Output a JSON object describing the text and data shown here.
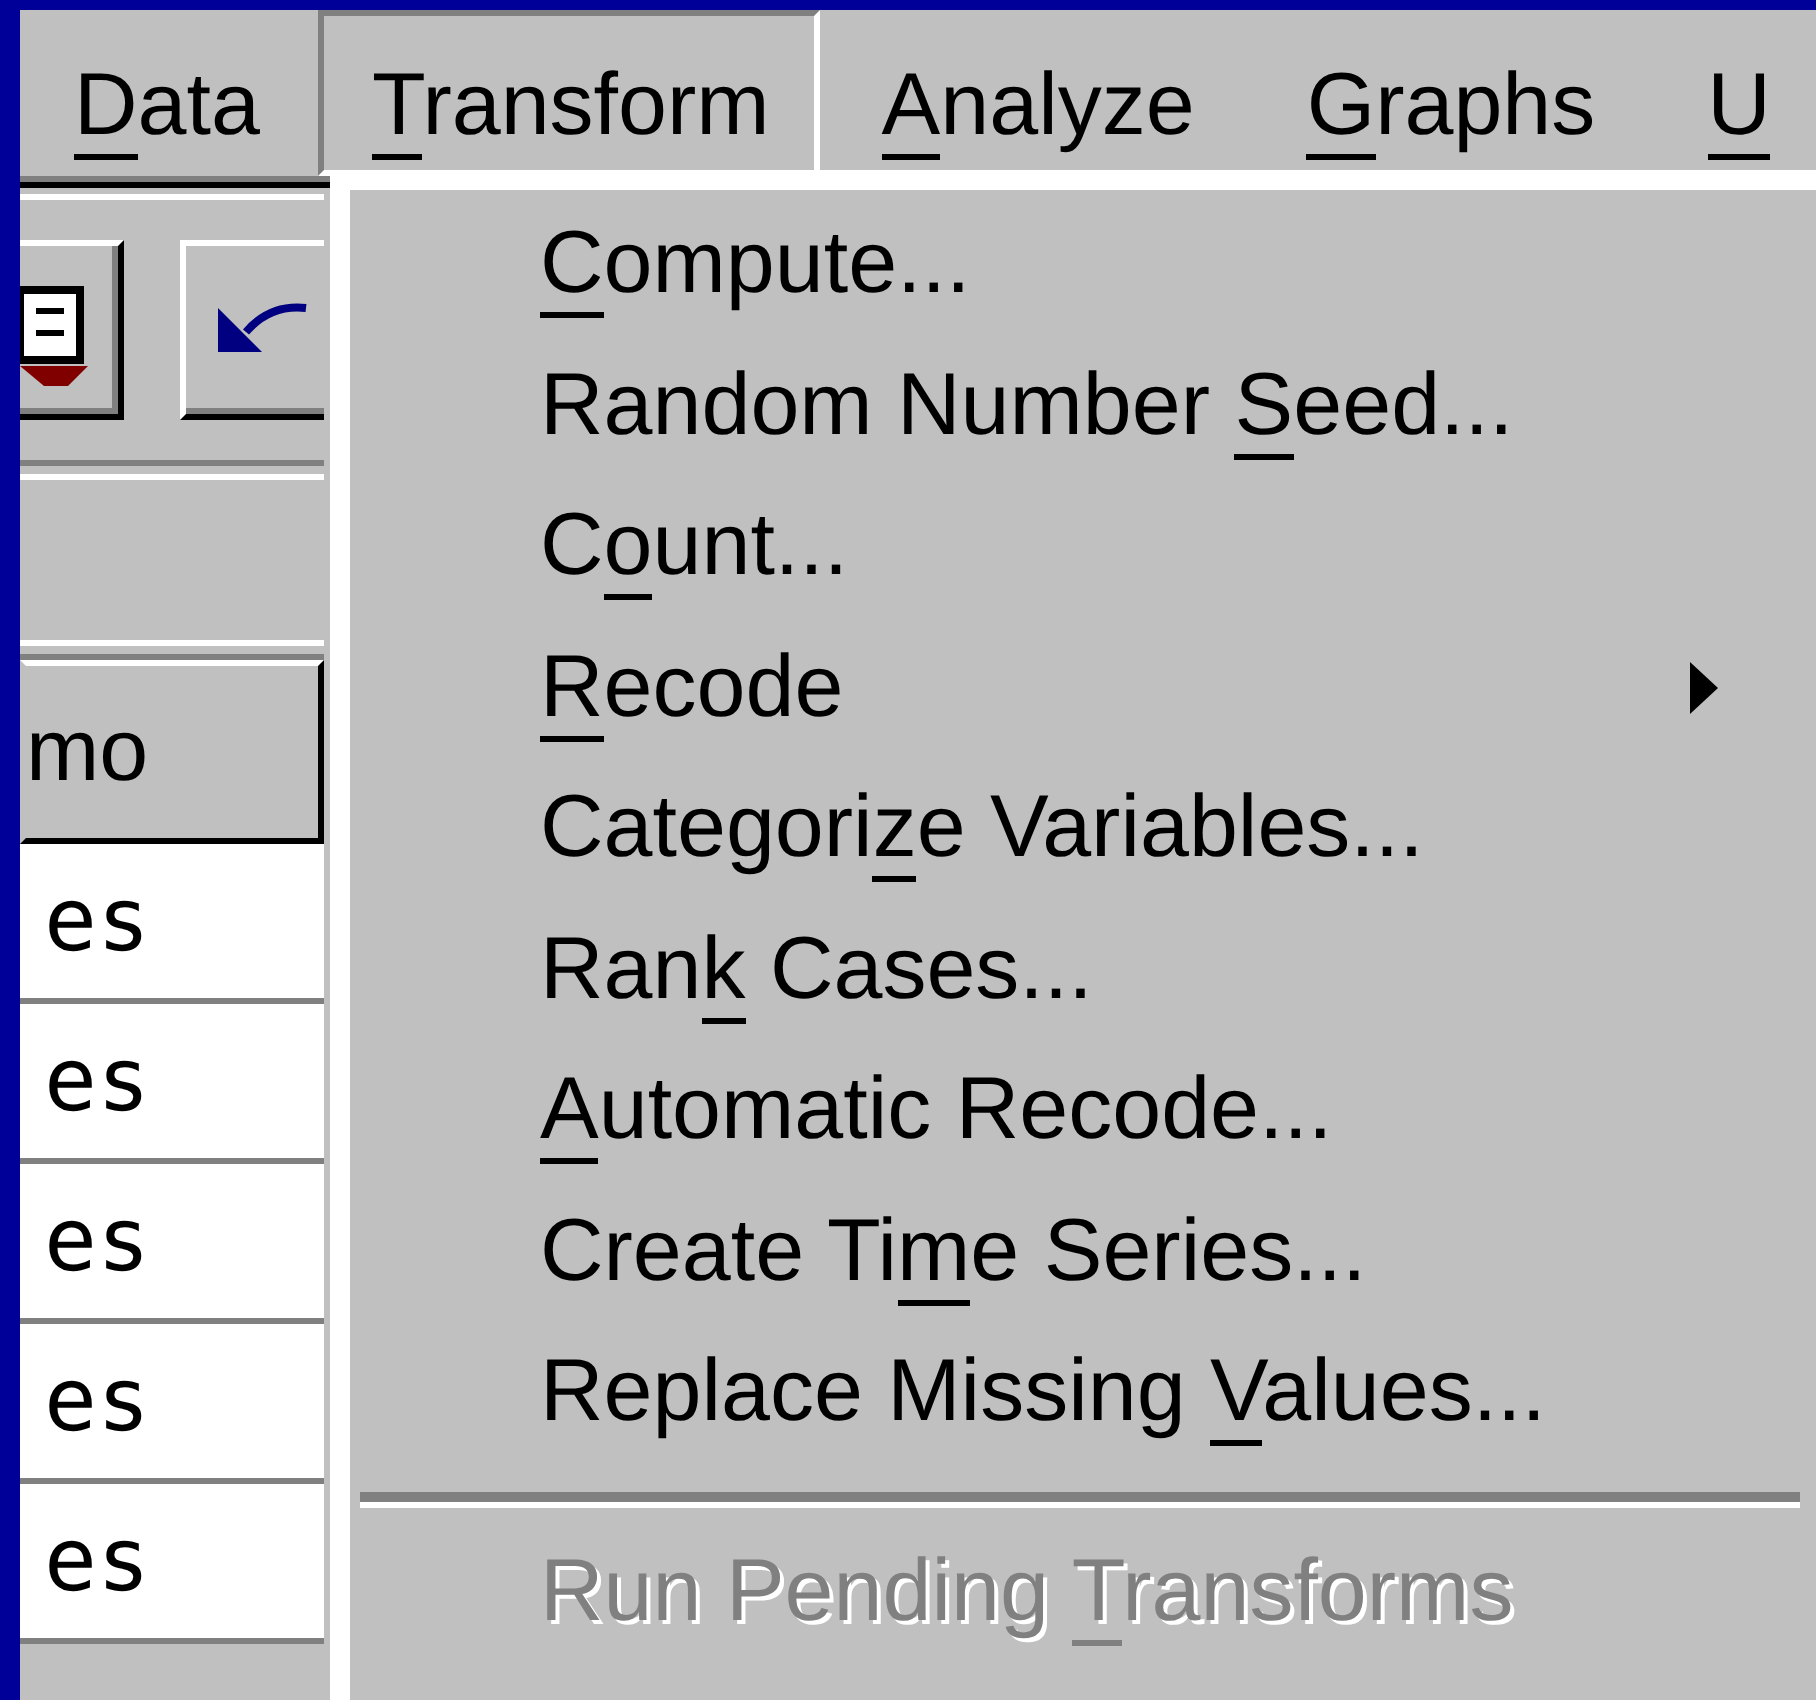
{
  "menu_bar": [
    {
      "parts": [
        {
          "text": "D",
          "underlined": true
        },
        {
          "text": "ata",
          "underlined": false
        }
      ],
      "selected": false
    },
    {
      "parts": [
        {
          "text": "T",
          "underlined": true
        },
        {
          "text": "ransform",
          "underlined": false
        }
      ],
      "selected": true
    },
    {
      "parts": [
        {
          "text": "A",
          "underlined": true
        },
        {
          "text": "nalyze",
          "underlined": false
        }
      ],
      "selected": false
    },
    {
      "parts": [
        {
          "text": "G",
          "underlined": true
        },
        {
          "text": "raphs",
          "underlined": false
        }
      ],
      "selected": false
    },
    {
      "parts": [
        {
          "text": "U",
          "underlined": true
        }
      ],
      "selected": false
    }
  ],
  "data_grid": {
    "column_header": "mo",
    "rows": [
      "es",
      "es",
      "es",
      "es",
      "es"
    ]
  },
  "transform_menu": [
    {
      "kind": "item",
      "disabled": false,
      "submenu": false,
      "parts": [
        {
          "text": "C",
          "underlined": true
        },
        {
          "text": "ompute...",
          "underlined": false
        }
      ]
    },
    {
      "kind": "item",
      "disabled": false,
      "submenu": false,
      "parts": [
        {
          "text": "Random Number ",
          "underlined": false
        },
        {
          "text": "S",
          "underlined": true
        },
        {
          "text": "eed...",
          "underlined": false
        }
      ]
    },
    {
      "kind": "item",
      "disabled": false,
      "submenu": false,
      "parts": [
        {
          "text": "C",
          "underlined": false
        },
        {
          "text": "o",
          "underlined": true
        },
        {
          "text": "unt...",
          "underlined": false
        }
      ]
    },
    {
      "kind": "item",
      "disabled": false,
      "submenu": true,
      "parts": [
        {
          "text": "R",
          "underlined": true
        },
        {
          "text": "ecode",
          "underlined": false
        }
      ]
    },
    {
      "kind": "item",
      "disabled": false,
      "submenu": false,
      "parts": [
        {
          "text": "Categori",
          "underlined": false
        },
        {
          "text": "z",
          "underlined": true
        },
        {
          "text": "e Variables...",
          "underlined": false
        }
      ]
    },
    {
      "kind": "item",
      "disabled": false,
      "submenu": false,
      "parts": [
        {
          "text": "Ran",
          "underlined": false
        },
        {
          "text": "k",
          "underlined": true
        },
        {
          "text": " Cases...",
          "underlined": false
        }
      ]
    },
    {
      "kind": "item",
      "disabled": false,
      "submenu": false,
      "parts": [
        {
          "text": "A",
          "underlined": true
        },
        {
          "text": "utomatic Recode...",
          "underlined": false
        }
      ]
    },
    {
      "kind": "item",
      "disabled": false,
      "submenu": false,
      "parts": [
        {
          "text": "Create Ti",
          "underlined": false
        },
        {
          "text": "m",
          "underlined": true
        },
        {
          "text": "e Series...",
          "underlined": false
        }
      ]
    },
    {
      "kind": "item",
      "disabled": false,
      "submenu": false,
      "parts": [
        {
          "text": "Replace Missing ",
          "underlined": false
        },
        {
          "text": "V",
          "underlined": true
        },
        {
          "text": "alues...",
          "underlined": false
        }
      ]
    },
    {
      "kind": "separator"
    },
    {
      "kind": "item",
      "disabled": true,
      "submenu": false,
      "parts": [
        {
          "text": "Run Pending ",
          "underlined": false
        },
        {
          "text": "T",
          "underlined": true
        },
        {
          "text": "ransforms",
          "underlined": false
        }
      ]
    }
  ]
}
